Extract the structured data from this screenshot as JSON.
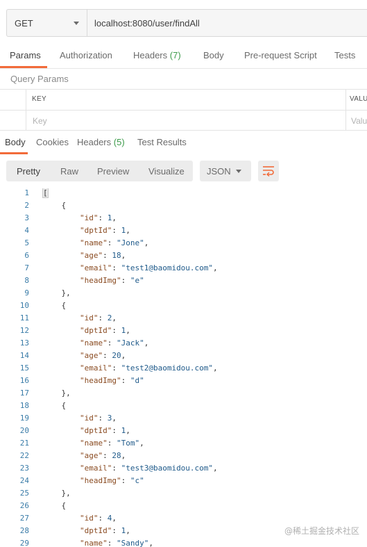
{
  "request": {
    "method": "GET",
    "url": "localhost:8080/user/findAll"
  },
  "request_tabs": {
    "params": "Params",
    "authorization": "Authorization",
    "headers": "Headers",
    "headers_count": "(7)",
    "body": "Body",
    "prerequest": "Pre-request Script",
    "tests": "Tests"
  },
  "query_params": {
    "title": "Query Params",
    "col_key": "KEY",
    "col_value": "VALU",
    "key_placeholder": "Key",
    "value_placeholder": "Valu"
  },
  "response_tabs": {
    "body": "Body",
    "cookies": "Cookies",
    "headers": "Headers",
    "headers_count": "(5)",
    "test_results": "Test Results"
  },
  "view_modes": {
    "pretty": "Pretty",
    "raw": "Raw",
    "preview": "Preview",
    "visualize": "Visualize"
  },
  "format": "JSON",
  "colors": {
    "accent": "#f26b3a",
    "count_green": "#3d9b4b",
    "line_number": "#3a7ca8"
  },
  "code_lines": [
    "[",
    "    {",
    "        \"id\": 1,",
    "        \"dptId\": 1,",
    "        \"name\": \"Jone\",",
    "        \"age\": 18,",
    "        \"email\": \"test1@baomidou.com\",",
    "        \"headImg\": \"e\"",
    "    },",
    "    {",
    "        \"id\": 2,",
    "        \"dptId\": 1,",
    "        \"name\": \"Jack\",",
    "        \"age\": 20,",
    "        \"email\": \"test2@baomidou.com\",",
    "        \"headImg\": \"d\"",
    "    },",
    "    {",
    "        \"id\": 3,",
    "        \"dptId\": 1,",
    "        \"name\": \"Tom\",",
    "        \"age\": 28,",
    "        \"email\": \"test3@baomidou.com\",",
    "        \"headImg\": \"c\"",
    "    },",
    "    {",
    "        \"id\": 4,",
    "        \"dptId\": 1,",
    "        \"name\": \"Sandy\","
  ],
  "watermark": "@稀土掘金技术社区"
}
